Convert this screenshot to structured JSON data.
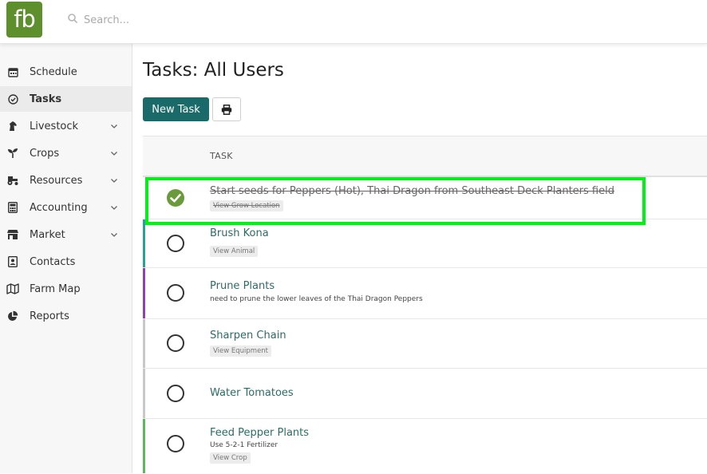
{
  "app": {
    "logo_text": "fb",
    "brand_color": "#5e8f2d"
  },
  "search": {
    "placeholder": "Search..."
  },
  "sidebar": {
    "items": [
      {
        "label": "Schedule",
        "icon": "calendar-icon",
        "expandable": false,
        "active": false
      },
      {
        "label": "Tasks",
        "icon": "check-circle-icon",
        "expandable": false,
        "active": true
      },
      {
        "label": "Livestock",
        "icon": "horse-icon",
        "expandable": true,
        "active": false
      },
      {
        "label": "Crops",
        "icon": "seedling-icon",
        "expandable": true,
        "active": false
      },
      {
        "label": "Resources",
        "icon": "tractor-icon",
        "expandable": true,
        "active": false
      },
      {
        "label": "Accounting",
        "icon": "calculator-icon",
        "expandable": true,
        "active": false
      },
      {
        "label": "Market",
        "icon": "store-icon",
        "expandable": true,
        "active": false
      },
      {
        "label": "Contacts",
        "icon": "contact-card-icon",
        "expandable": false,
        "active": false
      },
      {
        "label": "Farm Map",
        "icon": "map-icon",
        "expandable": false,
        "active": false
      },
      {
        "label": "Reports",
        "icon": "pie-chart-icon",
        "expandable": false,
        "active": false
      }
    ]
  },
  "main": {
    "title": "Tasks: All Users",
    "new_task_label": "New Task",
    "print_icon": "print-icon",
    "table": {
      "header_task": "TASK",
      "rows": [
        {
          "title": "Start seeds for Peppers (Hot), Thai Dragon from Southeast Deck Planters field",
          "note": "",
          "link": "View Grow Location",
          "completed": true,
          "bar_color": ""
        },
        {
          "title": "Brush Kona",
          "note": "",
          "link": "View Animal",
          "completed": false,
          "bar_color": "#2aa198"
        },
        {
          "title": "Prune Plants",
          "note": "need to prune the lower leaves of the Thai Dragon Peppers",
          "link": "",
          "completed": false,
          "bar_color": "#8e44ad"
        },
        {
          "title": "Sharpen Chain",
          "note": "",
          "link": "View Equipment",
          "completed": false,
          "bar_color": "#c8c8c8"
        },
        {
          "title": "Water Tomatoes",
          "note": "",
          "link": "",
          "completed": false,
          "bar_color": "#c8c8c8"
        },
        {
          "title": "Feed Pepper Plants",
          "note": "Use 5-2-1 Fertilizer",
          "link": "View Crop",
          "completed": false,
          "bar_color": "#5cb85c"
        }
      ]
    }
  },
  "colors": {
    "accent": "#1b6a6a",
    "completed_check": "#6a9a3a",
    "highlight": "#00f018"
  }
}
